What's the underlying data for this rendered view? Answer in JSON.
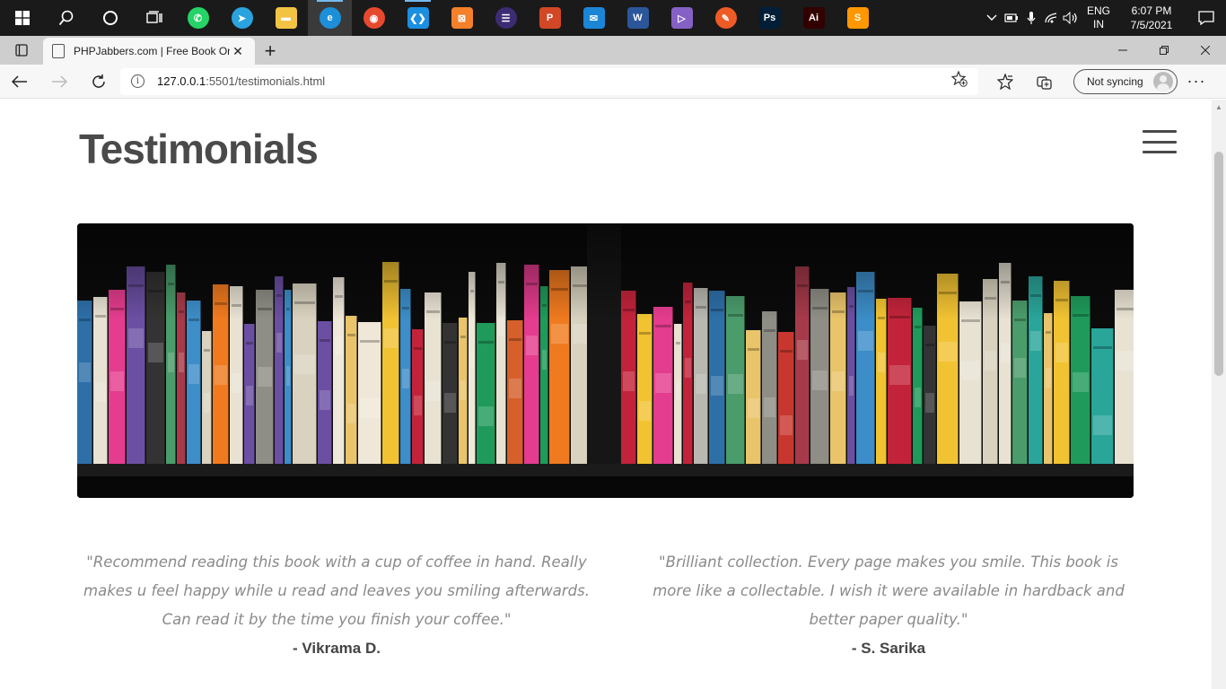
{
  "taskbar": {
    "apps": [
      {
        "name": "whatsapp",
        "glyph": "✆",
        "color": "#25d366"
      },
      {
        "name": "telegram",
        "glyph": "➤",
        "color": "#2aa3df"
      },
      {
        "name": "file-explorer",
        "glyph": "▬",
        "color": "#f3c443"
      },
      {
        "name": "edge",
        "glyph": "e",
        "color": "#1d8fd8"
      },
      {
        "name": "chrome",
        "glyph": "◉",
        "color": "#e7492f"
      },
      {
        "name": "vscode",
        "glyph": "❮❯",
        "color": "#1c8fe0"
      },
      {
        "name": "xampp",
        "glyph": "⊠",
        "color": "#f4802a"
      },
      {
        "name": "eclipse",
        "glyph": "☰",
        "color": "#3c2c73"
      },
      {
        "name": "powerpoint",
        "glyph": "P",
        "color": "#d24726"
      },
      {
        "name": "mail",
        "glyph": "✉",
        "color": "#1b86d6"
      },
      {
        "name": "word",
        "glyph": "W",
        "color": "#2b579a"
      },
      {
        "name": "visual-studio",
        "glyph": "▷",
        "color": "#8661c5"
      },
      {
        "name": "postman",
        "glyph": "✎",
        "color": "#ef5b25"
      },
      {
        "name": "photoshop",
        "glyph": "Ps",
        "color": "#001e36"
      },
      {
        "name": "illustrator",
        "glyph": "Ai",
        "color": "#330000"
      },
      {
        "name": "sublime-text",
        "glyph": "S",
        "color": "#ff9800"
      }
    ],
    "language": "ENG",
    "region": "IN",
    "time": "6:07 PM",
    "date": "7/5/2021"
  },
  "browser": {
    "tab_title": "PHPJabbers.com | Free Book Online",
    "url_host": "127.0.0.1",
    "url_path": ":5501/testimonials.html",
    "sync_label": "Not syncing"
  },
  "page": {
    "title": "Testimonials",
    "testimonials": [
      {
        "quote": "\"Recommend reading this book with a cup of coffee in hand. Really makes u feel happy while u read and leaves you smiling afterwards. Can read it by the time you finish your coffee.\"",
        "author": "- Vikrama D."
      },
      {
        "quote": "\"Brilliant collection. Every page makes you smile. This book is more like a collectable. I wish it were available in hardback and better paper quality.\"",
        "author": "- S. Sarika"
      }
    ]
  }
}
